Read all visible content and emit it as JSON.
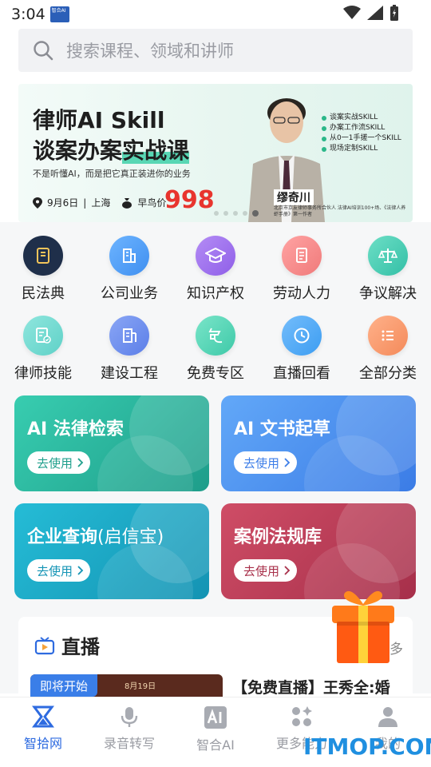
{
  "status_bar": {
    "time": "3:04",
    "app_mini_text": "智合AI"
  },
  "search": {
    "placeholder": "搜索课程、领域和讲师"
  },
  "banner": {
    "title_line1": "律师AI Skill",
    "title_line2_a": "谈案办案",
    "title_line2_b": "实战课",
    "subtitle": "不是听懂AI，而是把它真正装进你的业务",
    "date": "9月6日",
    "city": "上海",
    "early_bird_label": "早鸟价",
    "price": "998",
    "speaker_name": "缪奇川",
    "speaker_desc": "北京市京友律师事务所合伙人 法律AI培训100+场、《法律人养虾手册》第一作者",
    "skills": [
      "谈案实战SKILL",
      "办案工作流SKILL",
      "从0一1手搓一个SKILL",
      "现场定制SKILL"
    ]
  },
  "categories": [
    {
      "label": "民法典",
      "icon": "book-icon",
      "color": "#1f2f4a"
    },
    {
      "label": "公司业务",
      "icon": "building-icon",
      "color": "#3f8ff0"
    },
    {
      "label": "知识产权",
      "icon": "graduation-cap-icon",
      "color": "#8f5fe8"
    },
    {
      "label": "劳动人力",
      "icon": "document-icon",
      "color": "#f07a7a"
    },
    {
      "label": "争议解决",
      "icon": "scales-icon",
      "color": "#33bfa6"
    },
    {
      "label": "律师技能",
      "icon": "checklist-icon",
      "color": "#5fd1c7"
    },
    {
      "label": "建设工程",
      "icon": "construction-icon",
      "color": "#5b7ee8"
    },
    {
      "label": "免费专区",
      "icon": "free-icon",
      "color": "#3ec9a8"
    },
    {
      "label": "直播回看",
      "icon": "clock-icon",
      "color": "#3c9df2"
    },
    {
      "label": "全部分类",
      "icon": "list-icon",
      "color": "#f48a5a"
    }
  ],
  "ai_cards": [
    {
      "title": "AI 法律检索",
      "paren": "",
      "button": "去使用",
      "color_from": "#35c7a9",
      "color_to": "#1f9f8c",
      "btn_color": "#1f9f8c"
    },
    {
      "title": "AI 文书起草",
      "paren": "",
      "button": "去使用",
      "color_from": "#5aa0f5",
      "color_to": "#3d7ee8",
      "btn_color": "#3d7ee8"
    },
    {
      "title": "企业查询",
      "paren": "(启信宝)",
      "button": "去使用",
      "color_from": "#26b6d2",
      "color_to": "#1494b5",
      "btn_color": "#1494b5"
    },
    {
      "title": "案例法规库",
      "paren": "",
      "button": "去使用",
      "color_from": "#c94a62",
      "color_to": "#a8304a",
      "btn_color": "#a8304a"
    }
  ],
  "live": {
    "title": "直播",
    "more": "多",
    "badge": "即将开始",
    "thumb_date": "8月19日",
    "item_title": "【免费直播】王秀全:婚"
  },
  "tabbar": [
    {
      "label": "智拾网",
      "icon": "hourglass-icon",
      "active": true
    },
    {
      "label": "录音转写",
      "icon": "microphone-icon",
      "active": false
    },
    {
      "label": "智合AI",
      "icon": "ai-icon",
      "active": false
    },
    {
      "label": "更多能力",
      "icon": "apps-icon",
      "active": false
    },
    {
      "label": "我的",
      "icon": "profile-icon",
      "active": false
    }
  ],
  "watermark": "ITMOP.COM",
  "colors": {
    "brand": "#2e6be0",
    "accent_green": "#2bb789",
    "price_red": "#e8352e"
  }
}
